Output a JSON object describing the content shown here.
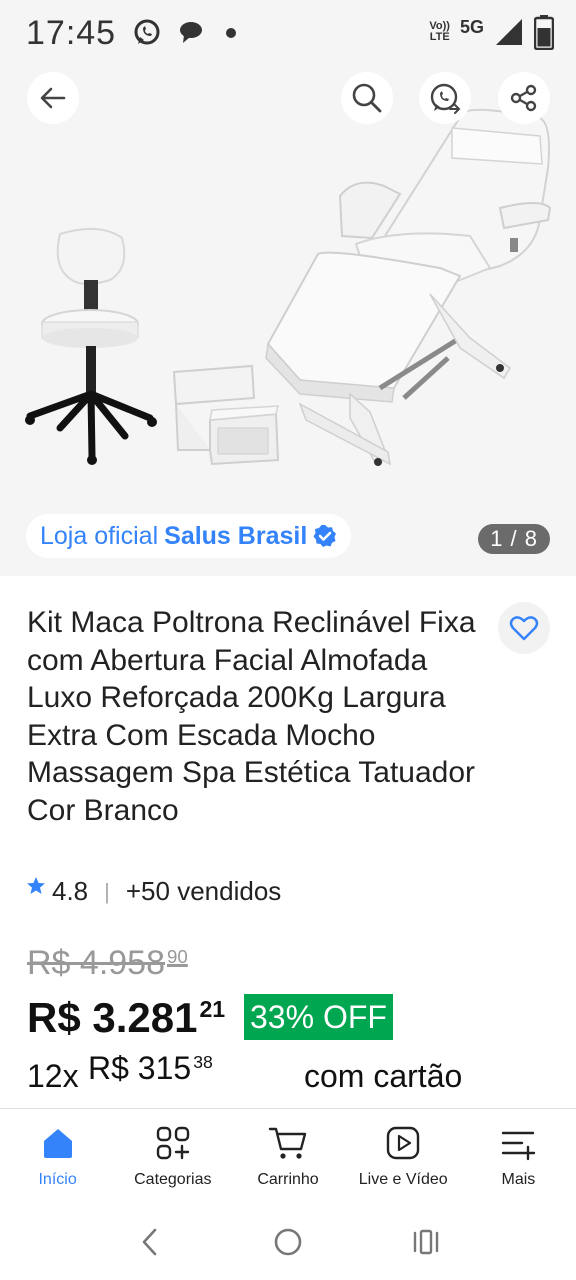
{
  "status_bar": {
    "time": "17:45",
    "volte_top": "Vo))",
    "volte_bottom": "LTE",
    "network": "5G"
  },
  "gallery": {
    "store_prefix": "Loja oficial",
    "store_name": "Salus Brasil",
    "image_counter": "1 / 8"
  },
  "product": {
    "title": "Kit Maca Poltrona Reclinável Fixa com Abertura Facial Almofada Luxo Reforçada 200Kg Largura Extra Com Escada Mocho Massagem Spa Estética Tatuador Cor Branco",
    "rating": "4.8",
    "sold": "+50 vendidos",
    "old_price_main": "R$ 4.958",
    "old_price_cents": "90",
    "price_main": "R$ 3.281",
    "price_cents": "21",
    "discount": "33% OFF",
    "installments_prefix": "12x",
    "installment_main": "R$ 315",
    "installment_cents": "38",
    "installments_suffix": "com cartão"
  },
  "bottom_nav": {
    "items": [
      {
        "label": "Início",
        "icon": "home-icon",
        "active": true
      },
      {
        "label": "Categorias",
        "icon": "categories-icon"
      },
      {
        "label": "Carrinho",
        "icon": "cart-icon"
      },
      {
        "label": "Live e Vídeo",
        "icon": "play-icon"
      },
      {
        "label": "Mais",
        "icon": "menu-plus-icon"
      }
    ]
  },
  "colors": {
    "accent": "#3483fa",
    "discount": "#00a650",
    "background": "#f5f5f5"
  }
}
